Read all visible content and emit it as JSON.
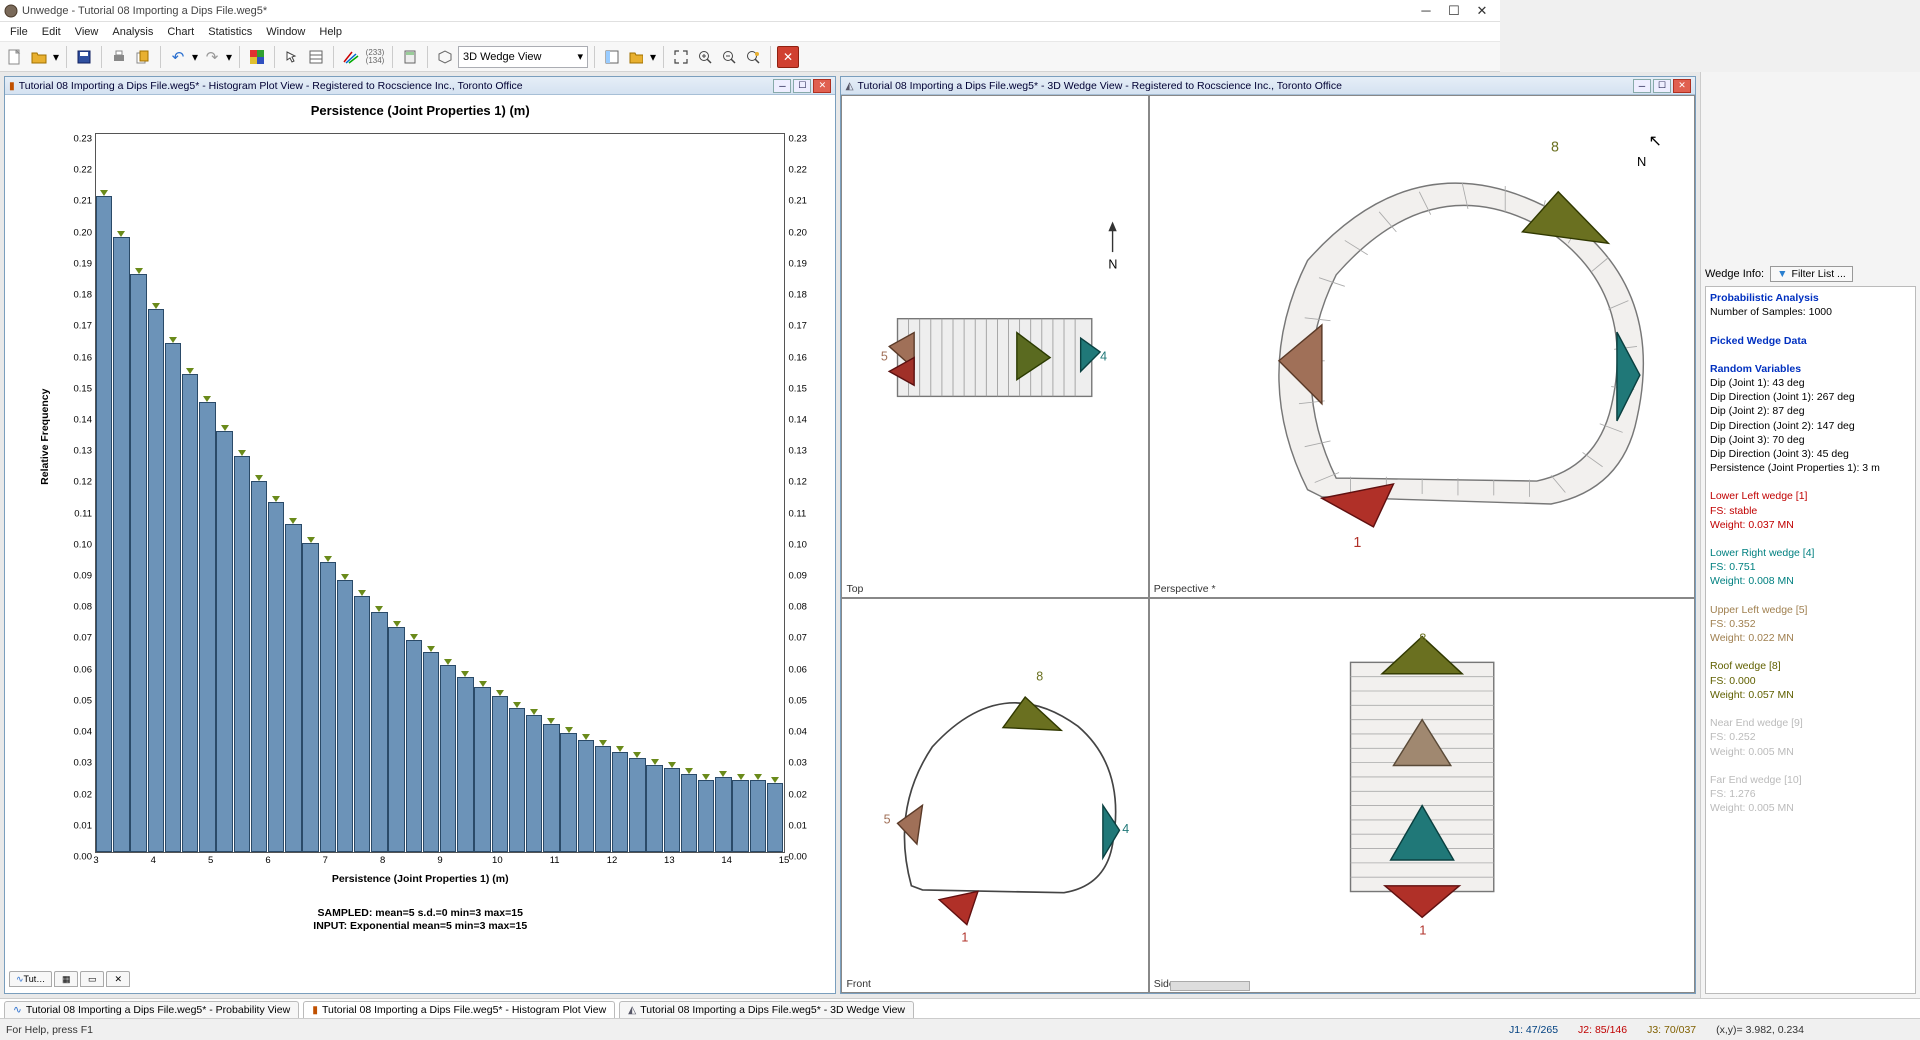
{
  "app": {
    "title": "Unwedge - Tutorial 08 Importing a Dips File.weg5*"
  },
  "menu": [
    "File",
    "Edit",
    "View",
    "Analysis",
    "Chart",
    "Statistics",
    "Window",
    "Help"
  ],
  "toolbar": {
    "view_combo": "3D Wedge View"
  },
  "mdi": {
    "left": {
      "title": "Tutorial 08 Importing a Dips File.weg5* - Histogram Plot View - Registered to Rocscience Inc., Toronto Office"
    },
    "right": {
      "title": "Tutorial 08 Importing a Dips File.weg5* - 3D Wedge View - Registered to Rocscience Inc., Toronto Office"
    }
  },
  "inner_tab": "Tut…",
  "chart_data": {
    "type": "bar",
    "title": "Persistence (Joint Properties 1) (m)",
    "xlabel": "Persistence (Joint Properties 1) (m)",
    "ylabel": "Relative Frequency",
    "ylim": [
      0,
      0.23
    ],
    "xlim": [
      3,
      15
    ],
    "x": [
      3.0,
      3.3,
      3.6,
      3.9,
      4.2,
      4.5,
      4.8,
      5.1,
      5.4,
      5.7,
      6.0,
      6.3,
      6.6,
      6.9,
      7.2,
      7.5,
      7.8,
      8.1,
      8.4,
      8.7,
      9.0,
      9.3,
      9.6,
      9.9,
      10.2,
      10.5,
      10.8,
      11.1,
      11.4,
      11.7,
      12.0,
      12.3,
      12.6,
      12.9,
      13.2,
      13.5,
      13.8,
      14.1,
      14.4,
      14.7
    ],
    "values": [
      0.21,
      0.197,
      0.185,
      0.174,
      0.163,
      0.153,
      0.144,
      0.135,
      0.127,
      0.119,
      0.112,
      0.105,
      0.099,
      0.093,
      0.087,
      0.082,
      0.077,
      0.072,
      0.068,
      0.064,
      0.06,
      0.056,
      0.053,
      0.05,
      0.046,
      0.044,
      0.041,
      0.038,
      0.036,
      0.034,
      0.032,
      0.03,
      0.028,
      0.027,
      0.025,
      0.023,
      0.024,
      0.023,
      0.023,
      0.022
    ],
    "yticks": [
      0.0,
      0.01,
      0.02,
      0.03,
      0.04,
      0.05,
      0.06,
      0.07,
      0.08,
      0.09,
      0.1,
      0.11,
      0.12,
      0.13,
      0.14,
      0.15,
      0.16,
      0.17,
      0.18,
      0.19,
      0.2,
      0.21,
      0.22,
      0.23
    ],
    "xticks": [
      3,
      4,
      5,
      6,
      7,
      8,
      9,
      10,
      11,
      12,
      13,
      14,
      15
    ],
    "footer1": "SAMPLED: mean=5 s.d.=0 min=3 max=15",
    "footer2": "INPUT: Exponential mean=5 min=3 max=15"
  },
  "views": {
    "top": "Top",
    "persp": "Perspective *",
    "front": "Front",
    "side": "Side"
  },
  "sidebar": {
    "label": "Wedge Info:",
    "filter": "Filter List ...",
    "prob_hdr": "Probabilistic Analysis",
    "samples": "Number of Samples: 1000",
    "picked_hdr": "Picked Wedge Data",
    "rand_hdr": "Random Variables",
    "rv": [
      "Dip (Joint 1): 43 deg",
      "Dip Direction (Joint 1): 267 deg",
      "Dip (Joint 2): 87 deg",
      "Dip Direction (Joint 2): 147 deg",
      "Dip (Joint 3): 70 deg",
      "Dip Direction (Joint 3): 45 deg",
      "Persistence (Joint Properties 1): 3 m"
    ],
    "w1": [
      "Lower Left wedge [1]",
      "FS: stable",
      "Weight: 0.037 MN"
    ],
    "w4": [
      "Lower Right wedge [4]",
      "FS: 0.751",
      "Weight: 0.008 MN"
    ],
    "w5": [
      "Upper Left wedge [5]",
      "FS: 0.352",
      "Weight: 0.022 MN"
    ],
    "w8": [
      "Roof wedge [8]",
      "FS: 0.000",
      "Weight: 0.057 MN"
    ],
    "w9": [
      "Near End wedge [9]",
      "FS: 0.252",
      "Weight: 0.005 MN"
    ],
    "w10": [
      "Far End wedge [10]",
      "FS: 1.276",
      "Weight: 0.005 MN"
    ]
  },
  "status": {
    "help": "For Help, press F1",
    "j1": "J1: 47/265",
    "j2": "J2: 85/146",
    "j3": "J3: 70/037",
    "xy": "(x,y)= 3.982, 0.234"
  },
  "bottom_tabs": [
    "Tutorial 08 Importing a Dips File.weg5* - Probability View",
    "Tutorial 08 Importing a Dips File.weg5* - Histogram Plot View",
    "Tutorial 08 Importing a Dips File.weg5* - 3D Wedge View"
  ]
}
